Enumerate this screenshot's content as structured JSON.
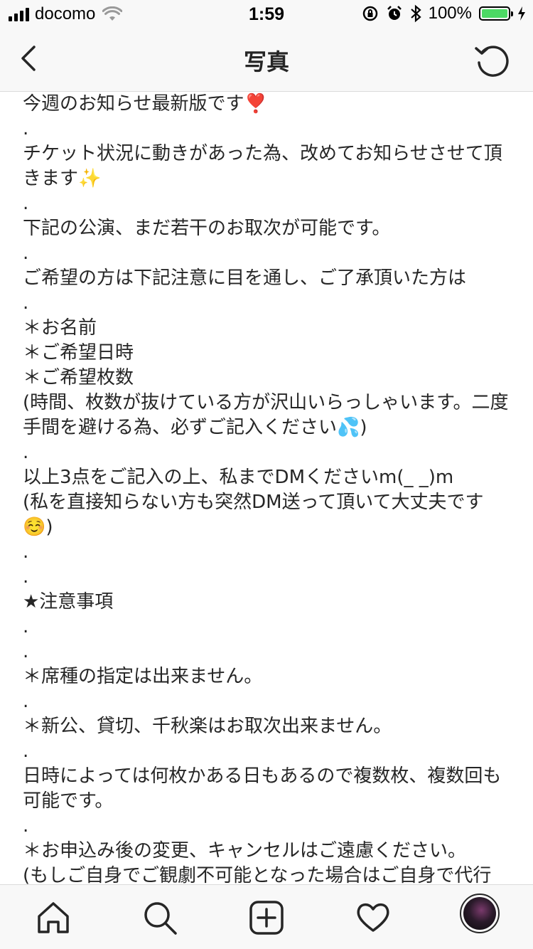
{
  "status_bar": {
    "carrier": "docomo",
    "time": "1:59",
    "battery_percent": "100%",
    "battery_level": 1.0
  },
  "nav": {
    "title": "写真",
    "back_icon": "chevron-left-icon",
    "refresh_icon": "refresh-icon"
  },
  "post": {
    "caption": "今週のお知らせ最新版です❣️\n.\nチケット状況に動きがあった為、改めてお知らせさせて頂きます✨\n.\n下記の公演、まだ若干のお取次が可能です。\n.\nご希望の方は下記注意に目を通し、ご了承頂いた方は\n.\n＊お名前\n＊ご希望日時\n＊ご希望枚数\n(時間、枚数が抜けている方が沢山いらっしゃいます。二度手間を避ける為、必ずご記入ください💦)\n.\n以上3点をご記入の上、私までDMくださいm(_ _)m\n(私を直接知らない方も突然DM送って頂いて大丈夫です☺️)\n.\n.\n★注意事項\n.\n.\n＊席種の指定は出来ません。\n.\n＊新公、貸切、千秋楽はお取次出来ません。\n.\n日時によっては何枚かある日もあるので複数枚、複数回も可能です。\n.\n＊お申込み後の変更、キャンセルはご遠慮ください。\n(もしご自身でご観劇不可能となった場合はご自身で代行"
  },
  "tab_bar": {
    "items": [
      "home-icon",
      "search-icon",
      "add-post-icon",
      "heart-icon",
      "profile-avatar"
    ]
  }
}
